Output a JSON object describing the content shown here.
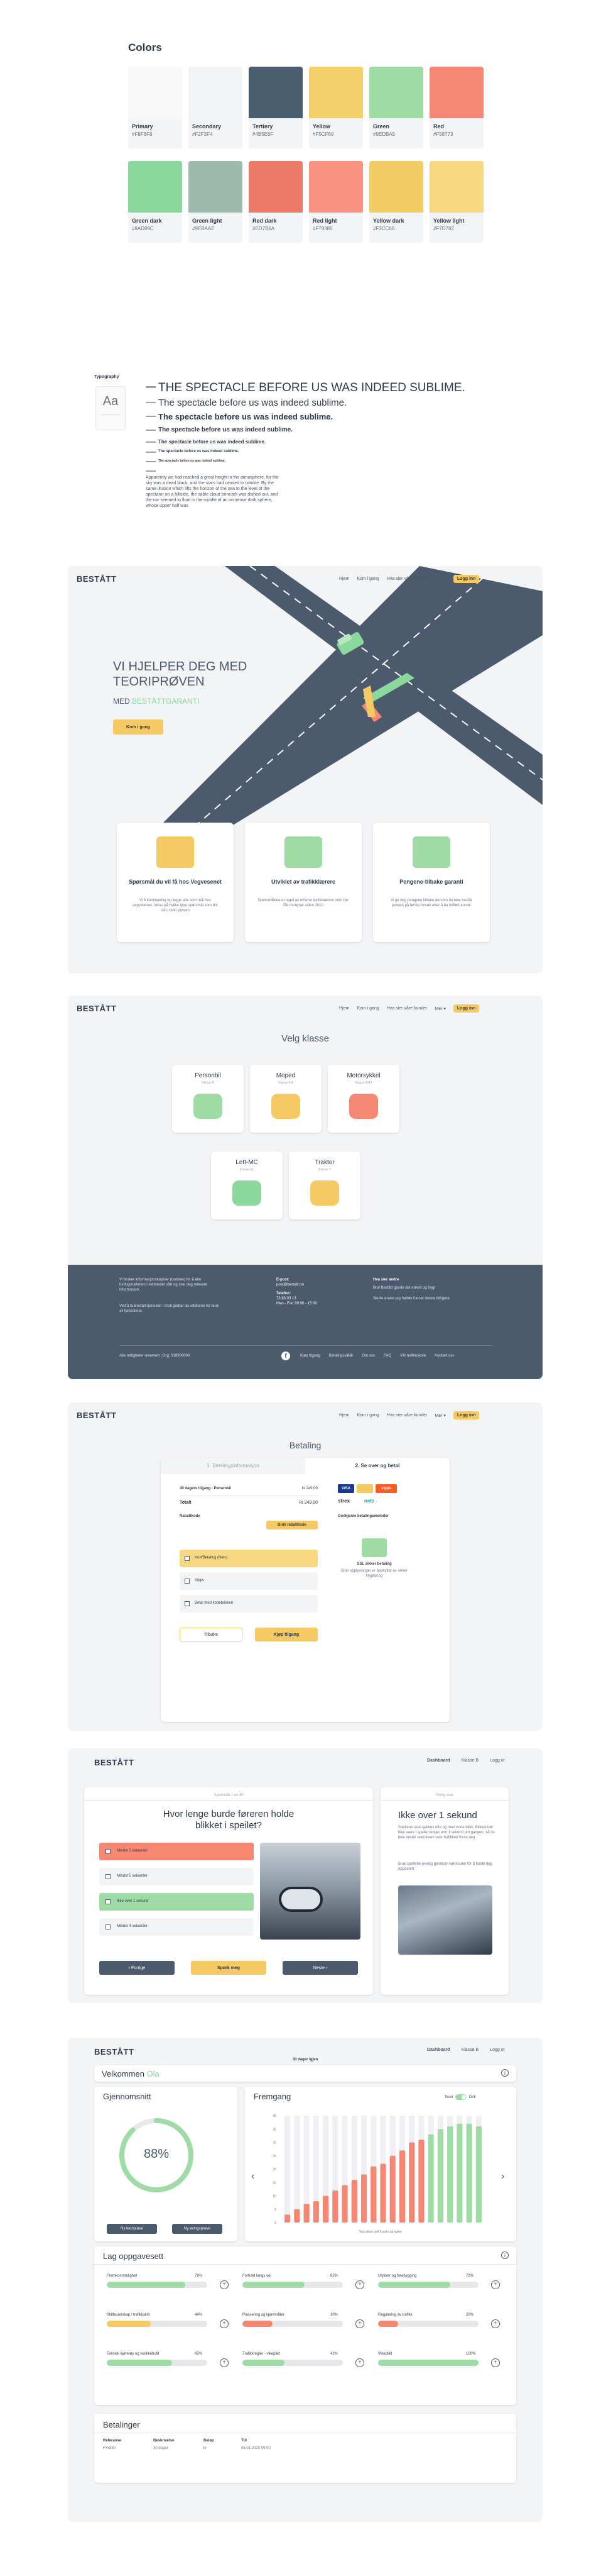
{
  "colors": {
    "title": "Colors",
    "row1": [
      {
        "name": "Primary",
        "hex": "#F8F8F8"
      },
      {
        "name": "Secondary",
        "hex": "#F2F3F4"
      },
      {
        "name": "Tertiery",
        "hex": "#4B5E6F"
      },
      {
        "name": "Yellow",
        "hex": "#F5CF69"
      },
      {
        "name": "Green",
        "hex": "#9EDBA5"
      },
      {
        "name": "Red",
        "hex": "#F58773"
      }
    ],
    "row2": [
      {
        "name": "Green dark",
        "hex": "#8AD89C"
      },
      {
        "name": "Green light",
        "hex": "#9EBAAE"
      },
      {
        "name": "Red dark",
        "hex": "#ED7B6A"
      },
      {
        "name": "Red light",
        "hex": "#F79380"
      },
      {
        "name": "Yellow dark",
        "hex": "#F3CC66"
      },
      {
        "name": "Yellow light",
        "hex": "#F7D782"
      }
    ]
  },
  "typography": {
    "label": "Typography",
    "sample": "Aa",
    "h1": "THE SPECTACLE BEFORE US WAS INDEED SUBLIME.",
    "h2": "The spectacle before us was indeed sublime.",
    "h3": "The spectacle before us was indeed sublime.",
    "h4": "The spectacle before us was indeed sublime.",
    "h5": "The spectacle before us was indeed sublime.",
    "h6": "The spectacle before us was indeed sublime.",
    "h7": "The spectacle before us was indeed sublime.",
    "paragraph": "Apparently we had reached a great height in the atmosphere, for the sky was a dead black, and the stars had ceased to twinkle. By the same illusion which lifts the horizon of the sea to the level of the spectator on a hillside, the sable cloud beneath was dished out, and the car seemed to float in the middle of an immense dark sphere, whose upper half was"
  },
  "nav": {
    "brand": "BESTÅTT",
    "items": [
      "Hjem",
      "Kom i gang",
      "Hva sier våre kunder",
      "Mer"
    ],
    "login": "Logg inn"
  },
  "hero": {
    "title_line1": "VI HJELPER DEG MED",
    "title_line2": "TEORIPRØVEN",
    "subtitle_prefix": "MED",
    "subtitle_highlight": "BESTÅTTGARANTI",
    "cta": "Kom i gang",
    "features": [
      {
        "title": "Spørsmål du vil få hos Vegvesenet",
        "text": "Vi 6 kontinuerlig og legge alle som mål hos vegvesenet, fokus på hvilke type spørsmål som blir stilt i teori prøven"
      },
      {
        "title": "Utviklet av trafikklærere",
        "text": "Spørsmålene er laget av erfarne trafikklærere som har fått mulighet siden 2010"
      },
      {
        "title": "Pengene-tilbake garanti",
        "text": "Vi gir deg pengene tilbake dersom du ikke består prøven på første forsøk etter å ha fullført kurset"
      }
    ]
  },
  "classes": {
    "title": "Velg klasse",
    "items": [
      {
        "name": "Personbil",
        "sub": "Klasse B"
      },
      {
        "name": "Moped",
        "sub": "Klasse AM"
      },
      {
        "name": "Motorsykkel",
        "sub": "Klasse A/A1"
      },
      {
        "name": "Lett-MC",
        "sub": "Klasse A1"
      },
      {
        "name": "Traktor",
        "sub": "Klasse T"
      }
    ]
  },
  "footer": {
    "text1": "Vi bruker informasjonskapsler (cookies) for å øke funksjonaliteten i nettstedet vårt og vise deg relevant informasjon.",
    "text2": "Ved å ta Bestått-tjenester i bruk godtar du vilkårene for bruk av tjenestene.",
    "email_label": "E-post:",
    "email": "post@bestatt.no",
    "phone_label": "Telefon:",
    "phone": "73 83 03 13",
    "hours": "Man - Fre: 09:00 - 15:00",
    "about_title": "Hva sier andre",
    "about_text1": "Bra! Bestått gjorde det enkelt og trygt",
    "about_text2": "Skulle ønske jeg hadde funnet denne tidligere",
    "copyright": "Alle rettigheter reservert | Org: 918900000",
    "links": [
      "Kjøp tilgang",
      "Betalingsvilkår",
      "Om oss",
      "FAQ",
      "Vår trafikkskole",
      "Kontakt oss"
    ]
  },
  "payment": {
    "title": "Betaling",
    "tab1": "1. Betalingsinformasjon",
    "tab2": "2. Se over og betal",
    "product": "30 dagers tilgang - Personbil",
    "product_price": "kr 249,00",
    "total_label": "Totalt",
    "total": "kr 249,00",
    "discount_label": "Rabattkode",
    "discount_btn": "Bruk rabattkode",
    "methods": [
      "Kort/Betaling (Nets)",
      "Vipps",
      "Betal med kodebrikken"
    ],
    "back": "Tilbake",
    "buy": "Kjøp tilgang",
    "right_title": "Godkjente betalingsmetoder",
    "secure_title": "SSL sikker betaling",
    "secure_text": "Dine opplysninger er beskyttet av sikker kryptering"
  },
  "quiz": {
    "nav_items": [
      "Dashboard",
      "Klasse B",
      "Logg ut"
    ],
    "counter": "Spørsmål 1 av 45",
    "question": "Hvor lenge burde føreren holde blikket i speilet?",
    "options": [
      "Mindst 3 sekunder",
      "Mindst 5 sekunder",
      "Ikke over 1 sekund",
      "Mindst 4 sekunder"
    ],
    "prev": "Forrige",
    "skip": "Spørk meg",
    "next": "Neste",
    "answer_tag": "Riktig svar",
    "answer_title": "Ikke over 1 sekund",
    "answer_text": "Speilene skal sjekkes ofte og med korte blikk. Blikket bør ikke være i speilet lenger enn 1 sekund om gangen, så du ikke mister oversikten over trafikken foran deg.",
    "answer_text2": "Bruk speilene jevnlig gjennom kjøreturen for å holde deg oppdatert."
  },
  "dashboard": {
    "nav_items": [
      "Dashboard",
      "Klasse B",
      "Logg ut"
    ],
    "days_left": "30 dager igjen",
    "welcome": "Velkommen",
    "welcome_name": "Ola",
    "avg_title": "Gjennomsnitt",
    "avg_value": "88%",
    "avg_fraction": 0.88,
    "btn_theory": "Ny teoriprøve",
    "btn_drill": "Ny øvingsprøve",
    "progress_title": "Fremgang",
    "toggle_a": "Teori",
    "toggle_b": "Drill",
    "chart_caption": "Ved siden ved 6 siste på nytter",
    "tasks_title": "Lag oppgavesett",
    "tasks": [
      {
        "name": "Fremkommelighet",
        "pct": "78%",
        "value": 0.78,
        "color": "#9edba5"
      },
      {
        "name": "Forhold langs vei",
        "pct": "62%",
        "value": 0.62,
        "color": "#9edba5"
      },
      {
        "name": "Ulykker og forebygging",
        "pct": "72%",
        "value": 0.72,
        "color": "#9edba5"
      },
      {
        "name": "Skiltkunnskap / trafikkskilt",
        "pct": "44%",
        "value": 0.44,
        "color": "#f5c964"
      },
      {
        "name": "Plassering og kjøremåter",
        "pct": "30%",
        "value": 0.3,
        "color": "#f58773"
      },
      {
        "name": "Regulering av trafikk",
        "pct": "20%",
        "value": 0.2,
        "color": "#f58773"
      },
      {
        "name": "Teknisk kjøretøy og vedlikehold",
        "pct": "65%",
        "value": 0.65,
        "color": "#9edba5"
      },
      {
        "name": "Trafikkregler - vikeplikt",
        "pct": "42%",
        "value": 0.42,
        "color": "#9edba5"
      },
      {
        "name": "Vikeplikt",
        "pct": "100%",
        "value": 1.0,
        "color": "#9edba5"
      }
    ],
    "payments_title": "Betalinger",
    "payments_headers": [
      "Referanse",
      "Beskrivelse",
      "Beløp",
      "Tid"
    ],
    "payments_row": [
      "F7x980",
      "30 dager",
      "kr",
      "05.01.2020 09:00"
    ]
  },
  "chart_data": {
    "type": "bar",
    "title": "Fremgang",
    "xlabel": "",
    "ylabel": "",
    "ylim": [
      0,
      40
    ],
    "yticks": [
      "40",
      "35",
      "30",
      "25",
      "20",
      "15",
      "10",
      "5",
      "0"
    ],
    "series": [
      {
        "values": [
          3,
          5,
          7,
          8,
          10,
          12,
          14,
          16,
          18,
          21,
          22,
          25,
          27,
          30,
          31,
          33,
          35,
          36,
          37,
          37,
          36
        ]
      }
    ],
    "colors": [
      "#f58773",
      "#f58773",
      "#f58773",
      "#f58773",
      "#f58773",
      "#f58773",
      "#f58773",
      "#f58773",
      "#f58773",
      "#f58773",
      "#f58773",
      "#f58773",
      "#f58773",
      "#f58773",
      "#f58773",
      "#9edba5",
      "#9edba5",
      "#9edba5",
      "#9edba5",
      "#9edba5",
      "#9edba5"
    ]
  }
}
